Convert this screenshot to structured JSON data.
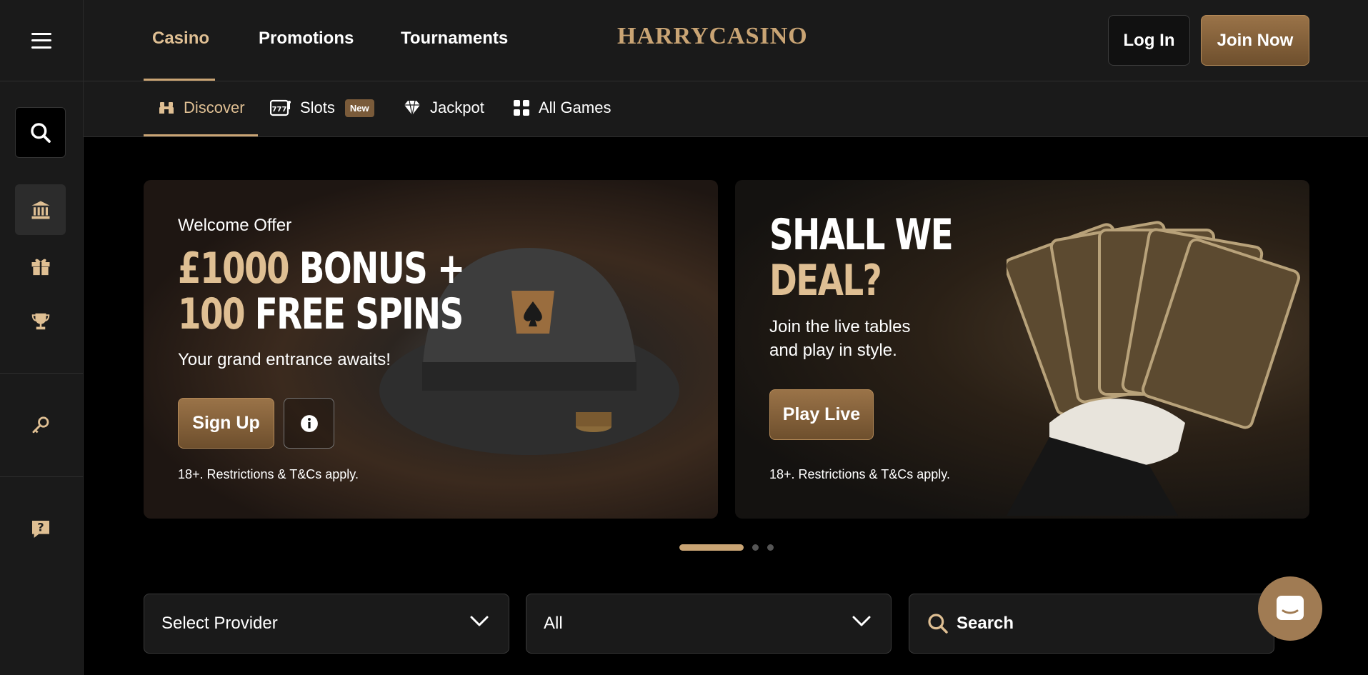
{
  "sidebar": {
    "menu_icon": "hamburger-icon",
    "items": [
      {
        "icon": "search-icon"
      },
      {
        "icon": "casino-bank-icon"
      },
      {
        "icon": "gift-icon"
      },
      {
        "icon": "trophy-icon"
      },
      {
        "icon": "key-icon"
      },
      {
        "icon": "help-icon"
      }
    ]
  },
  "header": {
    "nav": [
      "Casino",
      "Promotions",
      "Tournaments"
    ],
    "logo_left": "HARRY",
    "logo_right": "CASINO",
    "login_label": "Log In",
    "join_label": "Join Now"
  },
  "subnav": {
    "items": [
      {
        "label": "Discover",
        "icon": "binoculars-icon"
      },
      {
        "label": "Slots",
        "icon": "slot-machine-icon",
        "badge": "New"
      },
      {
        "label": "Jackpot",
        "icon": "diamond-icon"
      },
      {
        "label": "All Games",
        "icon": "grid-icon"
      }
    ]
  },
  "banners": [
    {
      "eyebrow": "Welcome Offer",
      "line1_gold": "£1000",
      "line1_white": "BONUS +",
      "line2_gold": "100",
      "line2_white": "FREE SPINS",
      "subtitle": "Your grand entrance awaits!",
      "cta": "Sign Up",
      "terms": "18+. Restrictions & T&Cs apply."
    },
    {
      "line1_white": "SHALL WE",
      "line2_gold": "DEAL?",
      "subtitle_1": "Join the live tables",
      "subtitle_2": "and play in style.",
      "cta": "Play Live",
      "terms": "18+. Restrictions & T&Cs apply."
    }
  ],
  "carousel": {
    "total": 3,
    "active": 1
  },
  "filters": {
    "provider": "Select Provider",
    "category": "All",
    "search_placeholder": "Search"
  },
  "colors": {
    "accent": "#c9a474",
    "gold_text": "#dfbf93",
    "background": "#000000",
    "panel": "#1a1a1a"
  }
}
